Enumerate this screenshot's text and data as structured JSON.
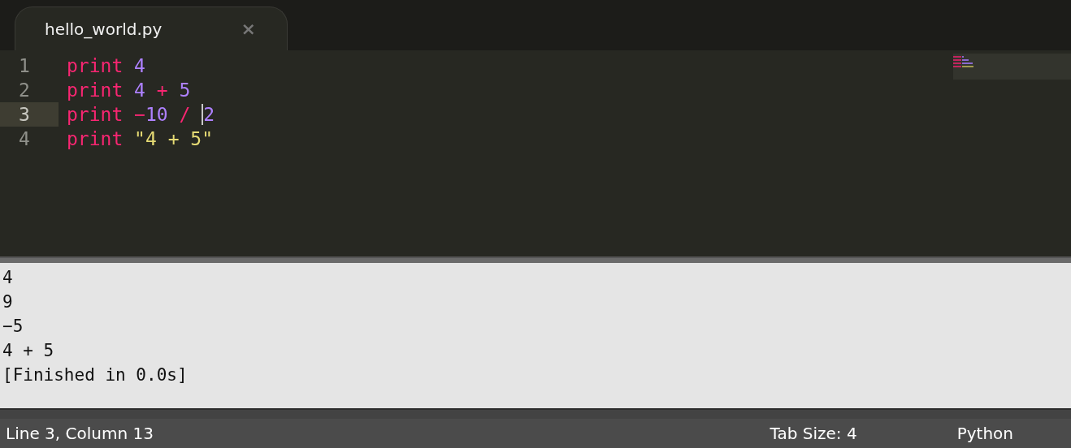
{
  "tabs": [
    {
      "label": "hello_world.py",
      "selected": true,
      "close": "×"
    }
  ],
  "editor": {
    "lines": [
      {
        "number": "1",
        "current": false,
        "tokens": [
          {
            "kind": "keyword",
            "text": "print",
            "cursor": false
          },
          {
            "kind": "number",
            "text": " 4",
            "cursor": false
          }
        ]
      },
      {
        "number": "2",
        "current": false,
        "tokens": [
          {
            "kind": "keyword",
            "text": "print",
            "cursor": false
          },
          {
            "kind": "number",
            "text": " 4",
            "cursor": false
          },
          {
            "kind": "operator",
            "text": " +",
            "cursor": false
          },
          {
            "kind": "number",
            "text": " 5",
            "cursor": false
          }
        ]
      },
      {
        "number": "3",
        "current": true,
        "tokens": [
          {
            "kind": "keyword",
            "text": "print",
            "cursor": false
          },
          {
            "kind": "operator",
            "text": " −",
            "cursor": false
          },
          {
            "kind": "number",
            "text": "10",
            "cursor": false
          },
          {
            "kind": "operator",
            "text": " / ",
            "cursor": false
          },
          {
            "kind": "number",
            "text": "2",
            "cursor": true
          }
        ]
      },
      {
        "number": "4",
        "current": false,
        "tokens": [
          {
            "kind": "keyword",
            "text": "print",
            "cursor": false
          },
          {
            "kind": "string",
            "text": " \"4 + 5\"",
            "cursor": false
          }
        ]
      }
    ]
  },
  "output": {
    "lines": [
      "4",
      "9",
      "−5",
      "4 + 5",
      "[Finished in 0.0s]"
    ]
  },
  "status_bar": {
    "position": "Line 3, Column 13",
    "tab_size": "Tab Size: 4",
    "syntax": "Python"
  }
}
